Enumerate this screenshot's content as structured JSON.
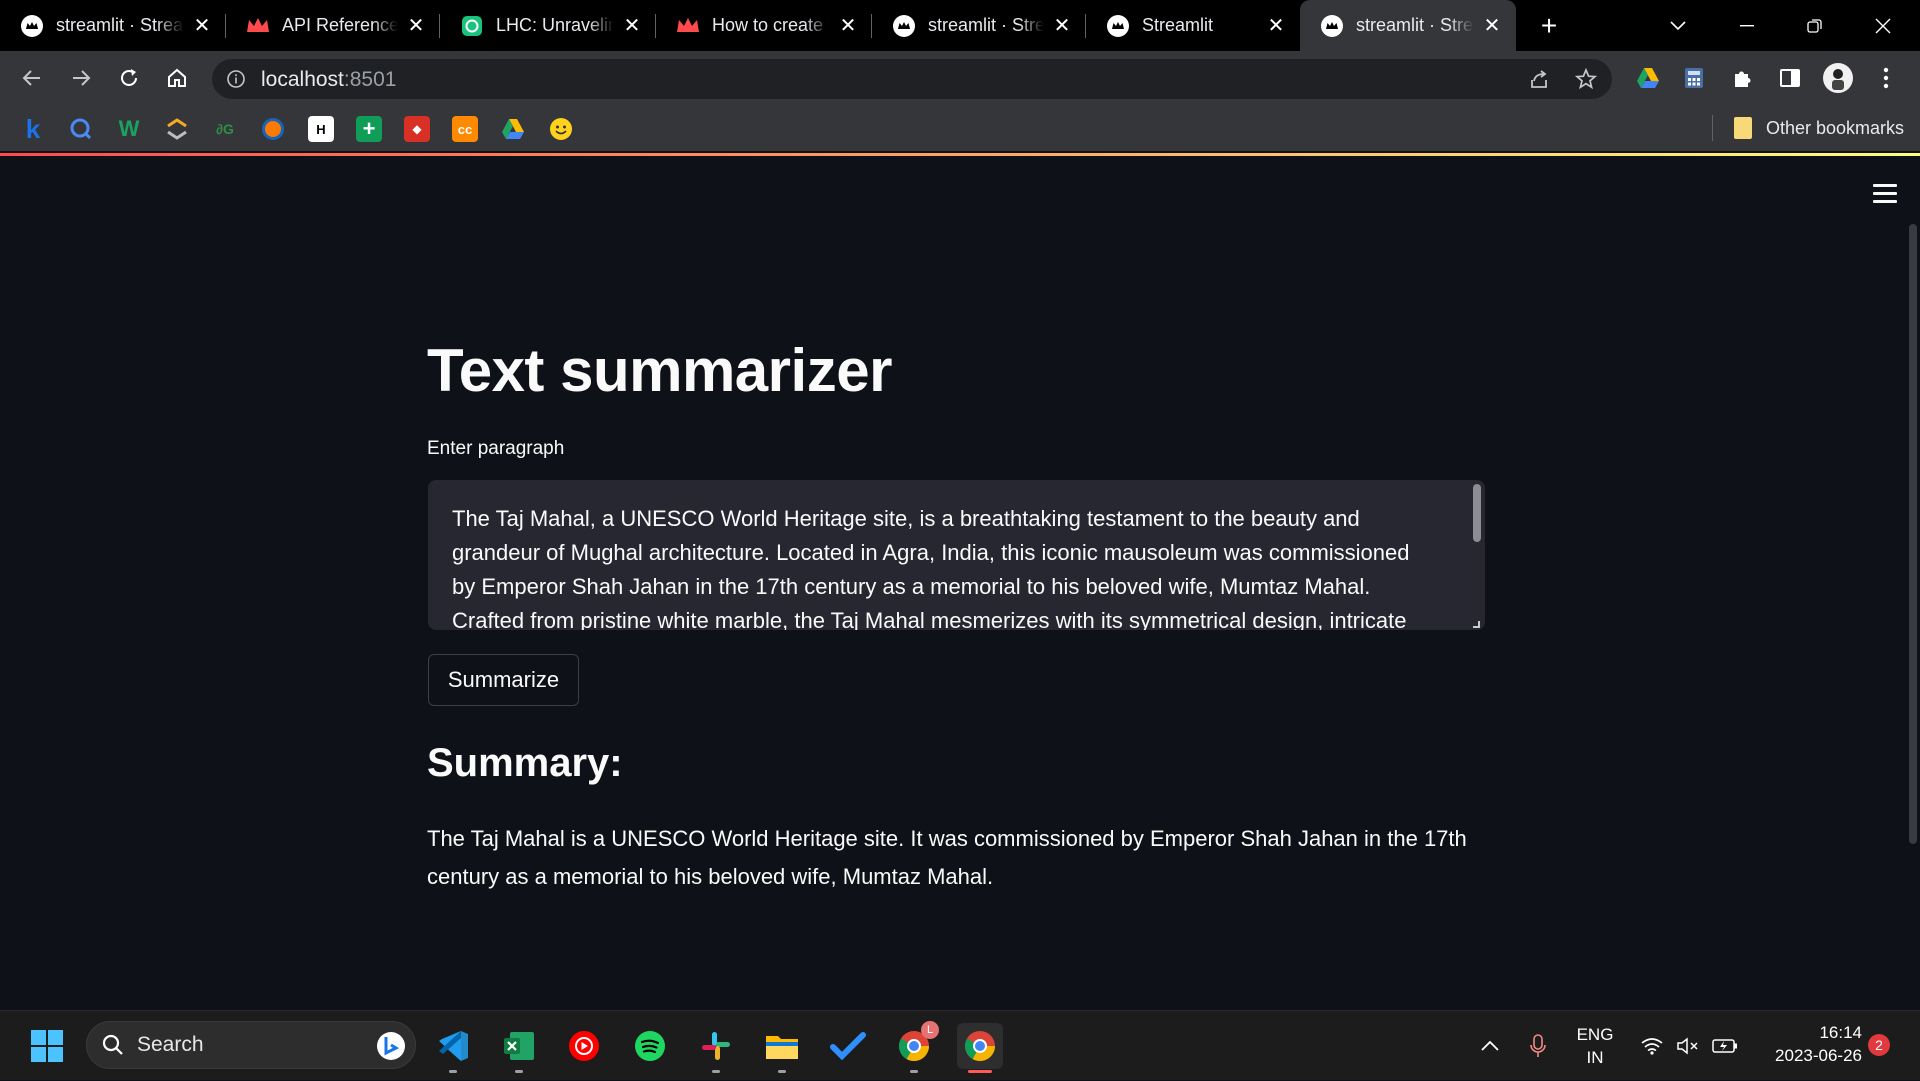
{
  "browser": {
    "tabs": [
      {
        "title": "streamlit · Strea",
        "icon": "streamlit-crown-icon",
        "active": false
      },
      {
        "title": "API Reference -",
        "icon": "streamlit-crown-red-icon",
        "active": false
      },
      {
        "title": "LHC: Unravelin",
        "icon": "openai-icon",
        "active": false
      },
      {
        "title": "How to create t",
        "icon": "streamlit-crown-red-icon",
        "active": false
      },
      {
        "title": "streamlit · Strea",
        "icon": "streamlit-crown-icon",
        "active": false
      },
      {
        "title": "Streamlit",
        "icon": "streamlit-crown-icon",
        "active": false
      },
      {
        "title": "streamlit · Strea",
        "icon": "streamlit-crown-icon",
        "active": true
      }
    ],
    "address": {
      "host": "localhost",
      "port": ":8501"
    },
    "bookmarks_other": "Other bookmarks"
  },
  "app": {
    "title": "Text summarizer",
    "input_label": "Enter paragraph",
    "input_value": "The Taj Mahal, a UNESCO World Heritage site, is a breathtaking testament to the beauty and grandeur of Mughal architecture. Located in Agra, India, this iconic mausoleum was commissioned by Emperor Shah Jahan in the 17th century as a memorial to his beloved wife, Mumtaz Mahal. Crafted from pristine white marble, the Taj Mahal mesmerizes with its symmetrical design, intricate",
    "button_label": "Summarize",
    "summary_heading": "Summary:",
    "summary_text": "The Taj Mahal is a UNESCO World Heritage site. It was commissioned by Emperor Shah Jahan in the 17th century as a memorial to his beloved wife, Mumtaz Mahal."
  },
  "taskbar": {
    "search_label": "Search",
    "language": {
      "line1": "ENG",
      "line2": "IN"
    },
    "clock": {
      "time": "16:14",
      "date": "2023-06-26"
    },
    "notification_count": "2",
    "chrome_badge": "L"
  },
  "colors": {
    "page_bg": "#0e1117",
    "textarea_bg": "#262730",
    "accent": "#ff4b4b"
  }
}
